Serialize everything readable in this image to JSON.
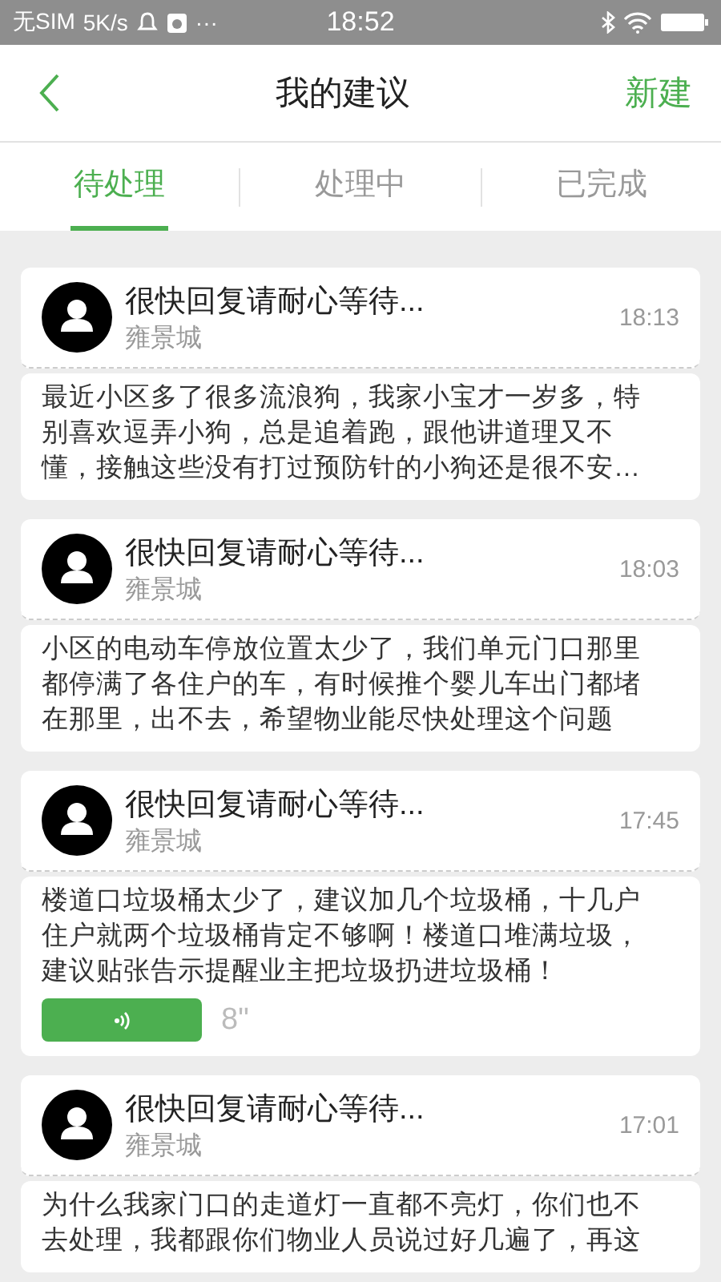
{
  "status_bar": {
    "carrier": "无SIM",
    "speed": "5K/s",
    "more": "···",
    "time": "18:52"
  },
  "nav": {
    "title": "我的建议",
    "action": "新建"
  },
  "tabs": [
    {
      "label": "待处理",
      "selected": true
    },
    {
      "label": "处理中",
      "selected": false
    },
    {
      "label": "已完成",
      "selected": false
    }
  ],
  "items": [
    {
      "title": "很快回复请耐心等待...",
      "community": "雍景城",
      "time": "18:13",
      "text": "最近小区多了很多流浪狗，我家小宝才一岁多，特别喜欢逗弄小狗，总是追着跑，跟他讲道理又不懂，接触这些没有打过预防针的小狗还是很不安…"
    },
    {
      "title": "很快回复请耐心等待...",
      "community": "雍景城",
      "time": "18:03",
      "text": "小区的电动车停放位置太少了，我们单元门口那里都停满了各住户的车，有时候推个婴儿车出门都堵在那里，出不去，希望物业能尽快处理这个问题"
    },
    {
      "title": "很快回复请耐心等待...",
      "community": "雍景城",
      "time": "17:45",
      "text": "楼道口垃圾桶太少了，建议加几个垃圾桶，十几户住户就两个垃圾桶肯定不够啊！楼道口堆满垃圾，建议贴张告示提醒业主把垃圾扔进垃圾桶！",
      "voice": {
        "duration": "8\""
      }
    },
    {
      "title": "很快回复请耐心等待...",
      "community": "雍景城",
      "time": "17:01",
      "text": "为什么我家门口的走道灯一直都不亮灯，你们也不去处理，我都跟你们物业人员说过好几遍了，再这"
    }
  ]
}
